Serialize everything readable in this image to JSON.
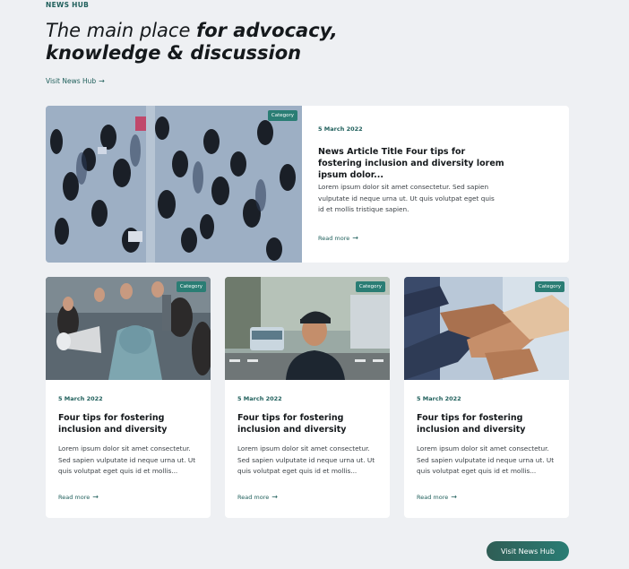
{
  "header": {
    "eyebrow": "NEWS HUB",
    "headline_light": "The main place ",
    "headline_bold_1": "for advocacy,",
    "headline_bold_2": "knowledge & discussion",
    "visit_link": "Visit News Hub",
    "arrow": "→"
  },
  "featured": {
    "badge": "Category",
    "date": "5 March 2022",
    "title": "News Article Title Four tips for fostering inclusion and diversity lorem ipsum dolor...",
    "excerpt": "Lorem ipsum dolor sit amet consectetur. Sed sapien vulputate id neque urna ut. Ut quis volutpat eget quis id et mollis tristique sapien.",
    "read_more": "Read more"
  },
  "cards": [
    {
      "badge": "Category",
      "date": "5 March 2022",
      "title": "Four tips for fostering inclusion and diversity",
      "excerpt": "Lorem ipsum dolor sit amet consectetur. Sed sapien vulputate id neque urna ut. Ut quis volutpat eget quis id et mollis...",
      "read_more": "Read more"
    },
    {
      "badge": "Category",
      "date": "5 March 2022",
      "title": "Four tips for fostering inclusion and diversity",
      "excerpt": "Lorem ipsum dolor sit amet consectetur. Sed sapien vulputate id neque urna ut. Ut quis volutpat eget quis id et mollis...",
      "read_more": "Read more"
    },
    {
      "badge": "Category",
      "date": "5 March 2022",
      "title": "Four tips for fostering inclusion and diversity",
      "excerpt": "Lorem ipsum dolor sit amet consectetur. Sed sapien vulputate id neque urna ut. Ut quis volutpat eget quis id et mollis...",
      "read_more": "Read more"
    }
  ],
  "cta": {
    "label": "Visit News Hub"
  },
  "colors": {
    "accent": "#1f5f5b",
    "badge": "#2a7d74",
    "background": "#eef0f3"
  },
  "icons": {
    "arrow": "arrow-right-icon"
  }
}
